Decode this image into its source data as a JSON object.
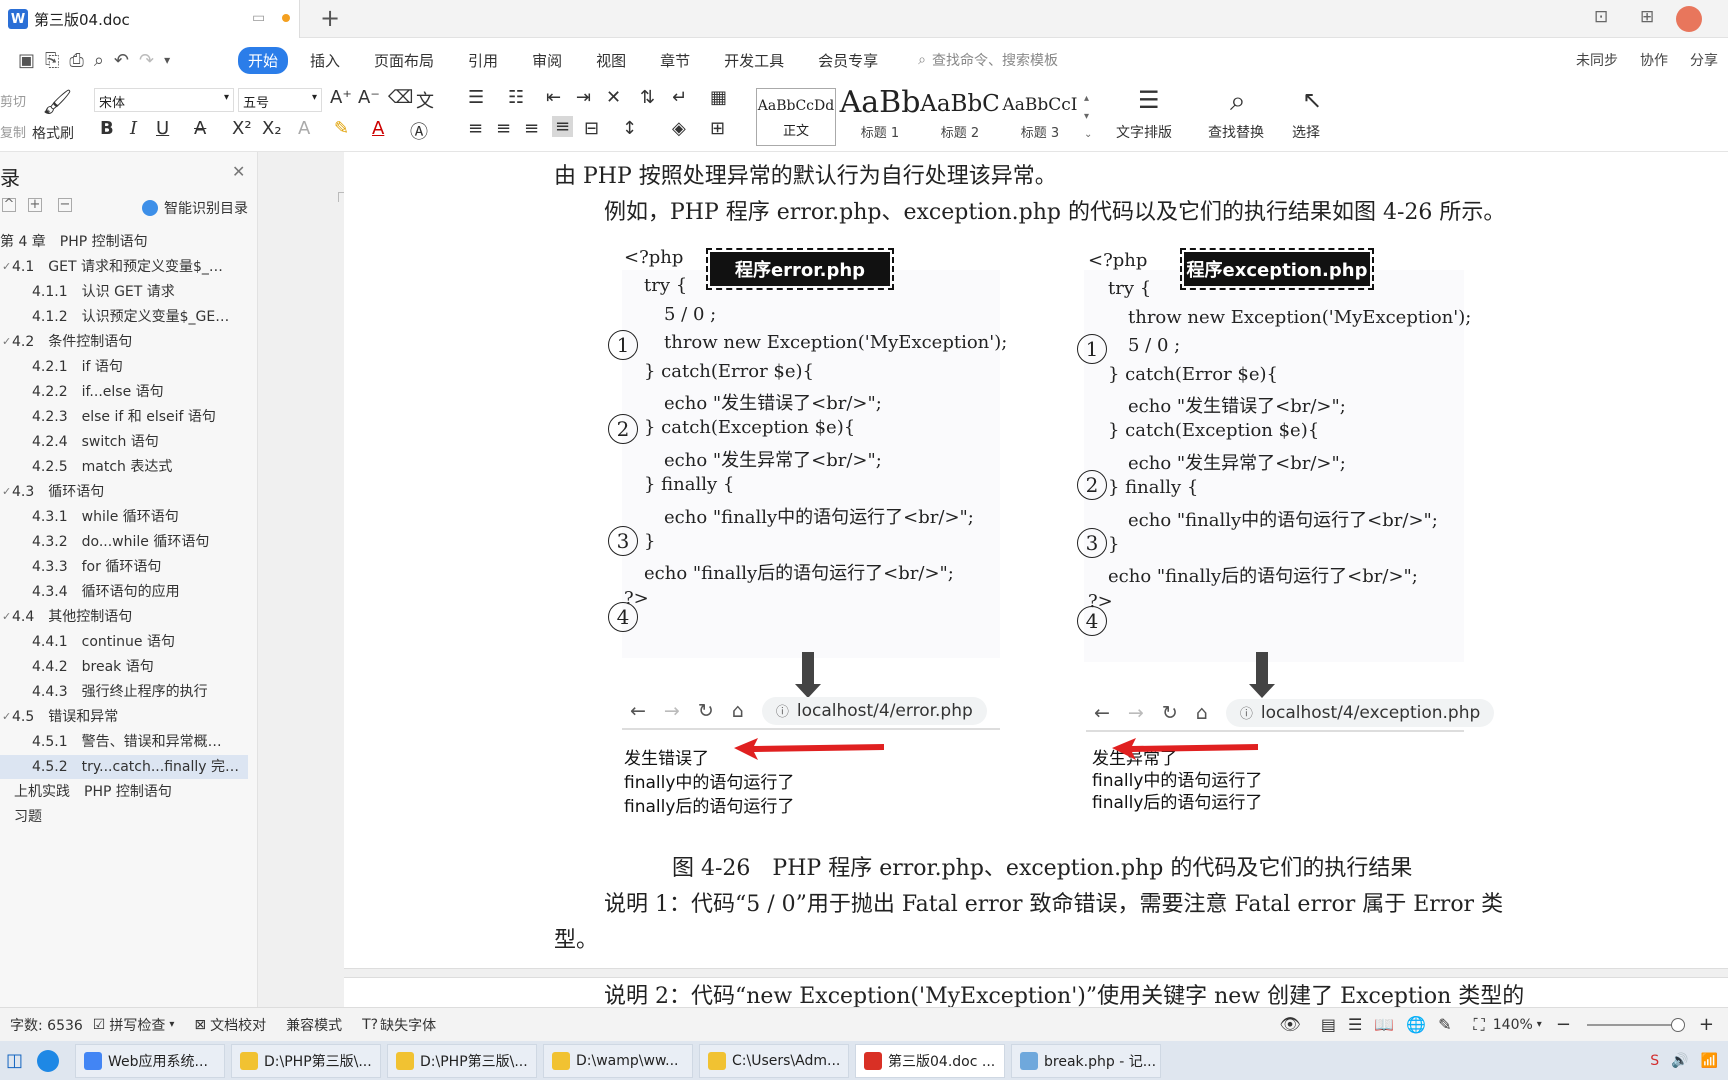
{
  "title_bar": {
    "doc_title": "第三版04.doc",
    "new_tab": "+"
  },
  "menu": {
    "items": [
      "开始",
      "插入",
      "页面布局",
      "引用",
      "审阅",
      "视图",
      "章节",
      "开发工具",
      "会员专享"
    ],
    "search_placeholder": "查找命令、搜索模板",
    "right": [
      "未同步",
      "协作",
      "分享"
    ]
  },
  "ribbon": {
    "clip_labels": [
      "剪切",
      "复制"
    ],
    "format_painter": "格式刷",
    "font_name": "宋体",
    "font_size": "五号",
    "styles": [
      {
        "preview": "AaBbCcDd",
        "label": "正文"
      },
      {
        "preview": "AaBb",
        "label": "标题 1"
      },
      {
        "preview": "AaBbC",
        "label": "标题 2"
      },
      {
        "preview": "AaBbCcI",
        "label": "标题 3"
      }
    ],
    "text_layout": "文字排版",
    "find_replace": "查找替换",
    "select": "选择"
  },
  "sidebar": {
    "title": "录",
    "smart_toc": "智能识别目录",
    "items": [
      "第 4 章　PHP 控制语句",
      "4.1　GET 请求和预定义变量$_…",
      "4.1.1　认识 GET 请求",
      "4.1.2　认识预定义变量$_GE…",
      "4.2　条件控制语句",
      "4.2.1　if 语句",
      "4.2.2　if...else 语句",
      "4.2.3　else if 和 elseif 语句",
      "4.2.4　switch 语句",
      "4.2.5　match 表达式",
      "4.3　循环语句",
      "4.3.1　while 循环语句",
      "4.3.2　do...while 循环语句",
      "4.3.3　for 循环语句",
      "4.3.4　循环语句的应用",
      "4.4　其他控制语句",
      "4.4.1　continue 语句",
      "4.4.2　break 语句",
      "4.4.3　强行终止程序的执行",
      "4.5　错误和异常",
      "4.5.1　警告、错误和异常概…",
      "4.5.2　try...catch...finally 完…",
      "上机实践　PHP 控制语句",
      "习题"
    ]
  },
  "document": {
    "line1": "由 PHP 按照处理异常的默认行为自行处理该异常。",
    "line2": "例如，PHP 程序 error.php、exception.php 的代码以及它们的执行结果如图 4-26 所示。",
    "left_title": "程序error.php",
    "right_title": "程序exception.php",
    "left_code": [
      "<?php",
      "try {",
      "5 / 0 ;",
      "throw new Exception('MyException');",
      "} catch(Error $e){",
      "echo \"发生错误了<br/>\";",
      "} catch(Exception $e){",
      "echo \"发生异常了<br/>\";",
      "} finally {",
      "echo \"finally中的语句运行了<br/>\";",
      "}",
      "echo \"finally后的语句运行了<br/>\";",
      "?>"
    ],
    "right_code": [
      "<?php",
      "try {",
      "throw new Exception('MyException');",
      "5 / 0 ;",
      "} catch(Error $e){",
      "echo \"发生错误了<br/>\";",
      "} catch(Exception $e){",
      "echo \"发生异常了<br/>\";",
      "} finally {",
      "echo \"finally中的语句运行了<br/>\";",
      "}",
      "echo \"finally后的语句运行了<br/>\";",
      "?>"
    ],
    "circles": [
      "1",
      "2",
      "3",
      "4"
    ],
    "left_url": "localhost/4/error.php",
    "right_url": "localhost/4/exception.php",
    "left_output": [
      "发生错误了",
      "finally中的语句运行了",
      "finally后的语句运行了"
    ],
    "right_output": [
      "发生异常了",
      "finally中的语句运行了",
      "finally后的语句运行了"
    ],
    "caption": "图 4-26　PHP 程序 error.php、exception.php 的代码及它们的执行结果",
    "note1a": "说明 1：代码“5 / 0”用于抛出 Fatal error 致命错误，需要注意 Fatal error 属于 Error 类",
    "note1b": "型。",
    "note2": "说明 2：代码“new Exception('MyException')”使用关键字 new 创建了 Exception 类型的"
  },
  "status": {
    "word_count": "字数: 6536",
    "spell": "拼写检查",
    "proof": "文档校对",
    "compat": "兼容模式",
    "missing_font": "缺失字体",
    "zoom": "140%"
  },
  "taskbar": [
    {
      "label": "Web应用系统...",
      "color": "#4285f4"
    },
    {
      "label": "D:\\PHP第三版\\...",
      "color": "#f1c232"
    },
    {
      "label": "D:\\PHP第三版\\...",
      "color": "#f1c232"
    },
    {
      "label": "D:\\wamp\\ww...",
      "color": "#f1c232"
    },
    {
      "label": "C:\\Users\\Adm...",
      "color": "#f1c232"
    },
    {
      "label": "第三版04.doc ...",
      "color": "#d93025"
    },
    {
      "label": "break.php - 记...",
      "color": "#6fa8dc"
    }
  ]
}
